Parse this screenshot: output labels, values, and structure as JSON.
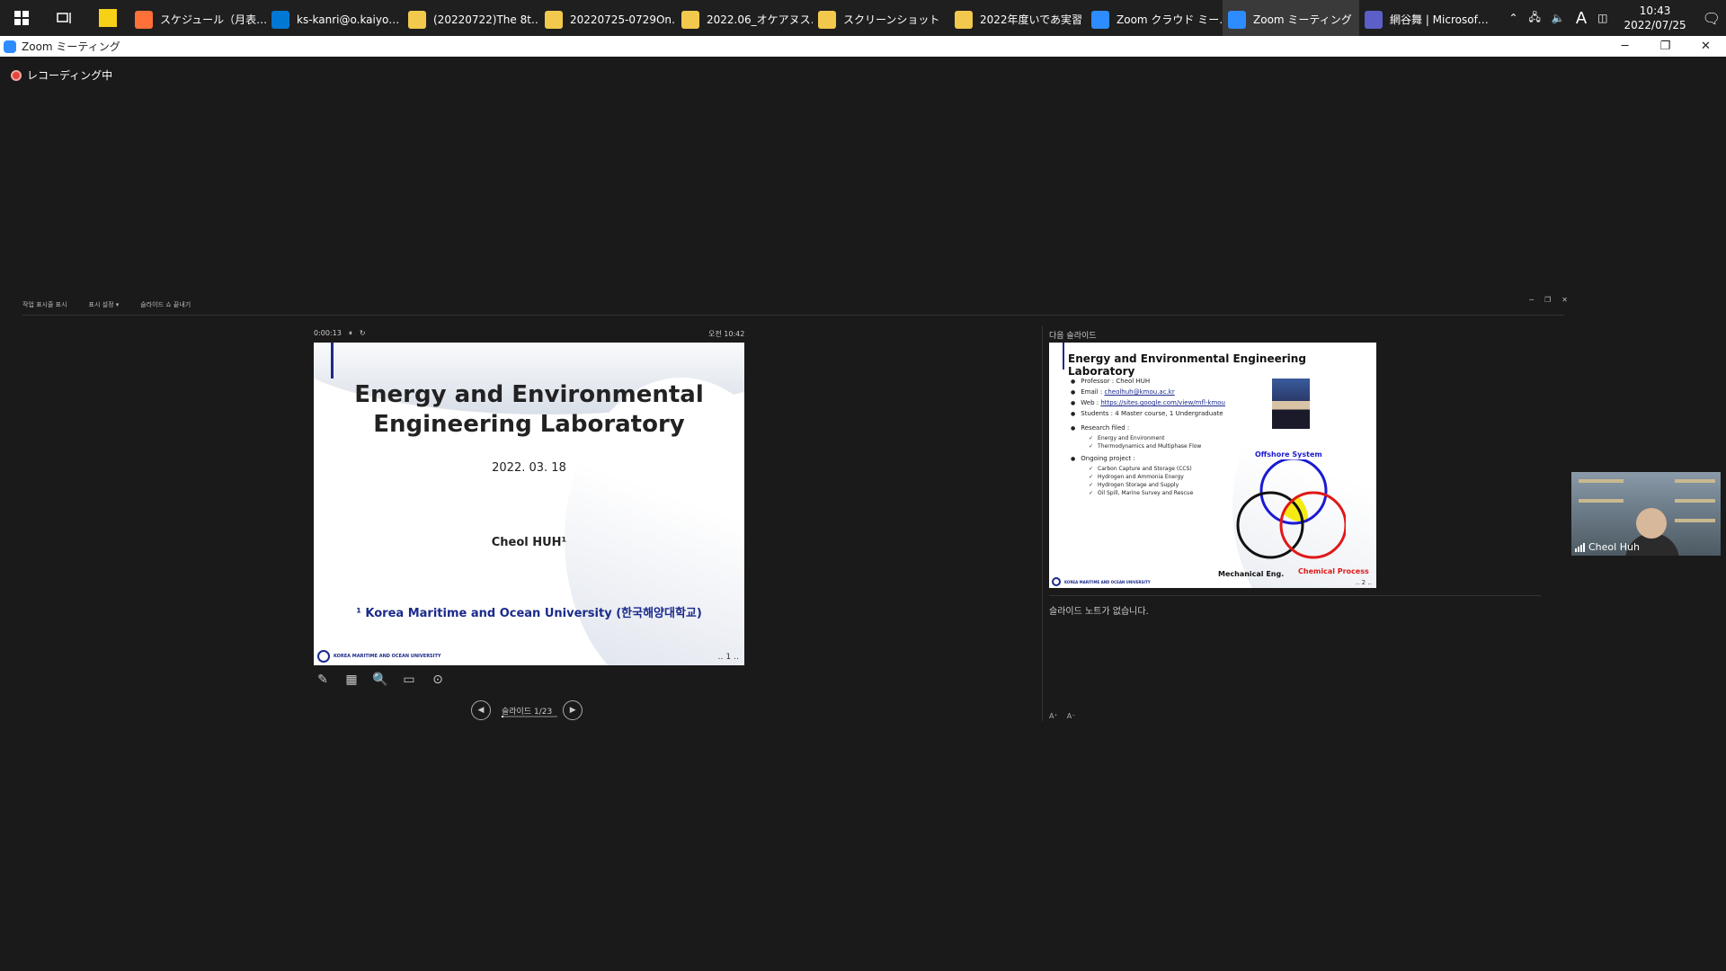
{
  "taskbar": {
    "apps": [
      {
        "label": "スケジュール（月表…",
        "color": "#ff7139"
      },
      {
        "label": "ks-kanri@o.kaiyo…",
        "color": "#0078d4"
      },
      {
        "label": "(20220722)The 8t…",
        "color": "#f2c94c"
      },
      {
        "label": "20220725-0729On…",
        "color": "#f2c94c"
      },
      {
        "label": "2022.06_オケアヌス…",
        "color": "#f2c94c"
      },
      {
        "label": "スクリーンショット",
        "color": "#f2c94c"
      },
      {
        "label": "2022年度いであ実習",
        "color": "#f2c94c"
      },
      {
        "label": "Zoom クラウド ミー…",
        "color": "#2d8cff"
      },
      {
        "label": "Zoom ミーティング",
        "color": "#2d8cff"
      },
      {
        "label": "網谷舞 | Microsof…",
        "color": "#5b5fc7"
      }
    ],
    "ime": "A",
    "time": "10:43",
    "date": "2022/07/25"
  },
  "window": {
    "title": "Zoom ミーティング",
    "recording": "レコーディング中"
  },
  "presenter": {
    "toolbar": [
      "작업 표시줄 표시",
      "표시 설정 ▾",
      "슬라이드 쇼 끝내기"
    ],
    "elapsed": "0:00:13",
    "clock": "오전 10:42",
    "slide_counter": "슬라이드 1/23",
    "progress": 0.04,
    "next_label": "다음 슬라이드",
    "notes": "슬라이드 노트가 없습니다."
  },
  "slide1": {
    "title_line1": "Energy and Environmental",
    "title_line2": "Engineering Laboratory",
    "date": "2022. 03. 18",
    "author": "Cheol HUH¹",
    "affiliation": "¹ Korea Maritime and Ocean University (한국해양대학교)",
    "footer": "KOREA MARITIME AND OCEAN UNIVERSITY",
    "page": "‥ 1 ‥"
  },
  "slide2": {
    "title": "Energy and Environmental Engineering Laboratory",
    "professor": "Professor : Cheol HUH",
    "email_label": "Email : ",
    "email": "cheolhuh@kmou.ac.kr",
    "web_label": "Web : ",
    "web": "https://sites.google.com/view/mfl-kmou",
    "students": "Students : 4 Master course, 1 Undergraduate",
    "research": "Research filed :",
    "research_items": [
      "Energy and Environment",
      "Thermodynamics and Multiphase Flow"
    ],
    "ongoing": "Ongoing project :",
    "ongoing_items": [
      "Carbon Capture and Storage (CCS)",
      "Hydrogen and Ammonia Energy",
      "Hydrogen Storage and Supply",
      "Oil Spill, Marine Survey and Rescue"
    ],
    "venn_top": "Offshore System",
    "venn_left": "Mechanical Eng.",
    "venn_right": "Chemical Process",
    "footer": "KOREA MARITIME AND OCEAN UNIVERSITY",
    "page": "‥ 2 ‥"
  },
  "video": {
    "name": "Cheol Huh"
  }
}
